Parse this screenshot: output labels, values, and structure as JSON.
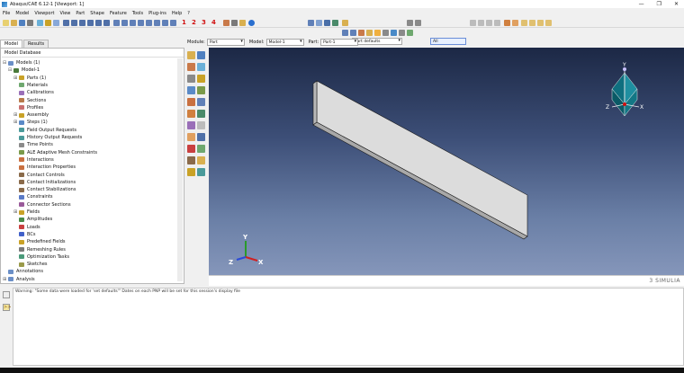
{
  "window": {
    "title": "Abaqus/CAE 6.12-1 [Viewport: 1]",
    "controls": [
      "—",
      "❐",
      "✕"
    ]
  },
  "menu": [
    "File",
    "Model",
    "Viewport",
    "View",
    "Part",
    "Shape",
    "Feature",
    "Tools",
    "Plug-ins",
    "Help",
    "?"
  ],
  "toolbar": {
    "numbers": [
      "1",
      "2",
      "3",
      "4"
    ],
    "render_combo": "Part defaults",
    "filter_value": "All"
  },
  "context_bar": {
    "module_label": "Module:",
    "module_value": "Part",
    "model_label": "Model:",
    "model_value": "Model-1",
    "part_label": "Part:",
    "part_value": "Part-1"
  },
  "left_tabs": [
    "Model",
    "Results"
  ],
  "tree": {
    "header": "Model Database",
    "items": [
      {
        "label": "Models (1)",
        "exp": "⊟",
        "indent": 0,
        "color": "#6b8fc7"
      },
      {
        "label": "Model-1",
        "exp": "⊟",
        "indent": 1,
        "color": "#4a7a3a"
      },
      {
        "label": "Parts (1)",
        "exp": "⊞",
        "indent": 2,
        "color": "#c9a227"
      },
      {
        "label": "Materials",
        "exp": "",
        "indent": 2,
        "color": "#6fa86f"
      },
      {
        "label": "Calibrations",
        "exp": "",
        "indent": 2,
        "color": "#9a6fb8"
      },
      {
        "label": "Sections",
        "exp": "",
        "indent": 2,
        "color": "#b87a4a"
      },
      {
        "label": "Profiles",
        "exp": "",
        "indent": 2,
        "color": "#c97070"
      },
      {
        "label": "Assembly",
        "exp": "⊞",
        "indent": 2,
        "color": "#c9a227"
      },
      {
        "label": "Steps (1)",
        "exp": "⊞",
        "indent": 2,
        "color": "#5a8ac7"
      },
      {
        "label": "Field Output Requests",
        "exp": "",
        "indent": 2,
        "color": "#4a9a9a"
      },
      {
        "label": "History Output Requests",
        "exp": "",
        "indent": 2,
        "color": "#4a9a9a"
      },
      {
        "label": "Time Points",
        "exp": "",
        "indent": 2,
        "color": "#8a8a8a"
      },
      {
        "label": "ALE Adaptive Mesh Constraints",
        "exp": "",
        "indent": 2,
        "color": "#7a9a4a"
      },
      {
        "label": "Interactions",
        "exp": "",
        "indent": 2,
        "color": "#c97040"
      },
      {
        "label": "Interaction Properties",
        "exp": "",
        "indent": 2,
        "color": "#c97040"
      },
      {
        "label": "Contact Controls",
        "exp": "",
        "indent": 2,
        "color": "#8a6a4a"
      },
      {
        "label": "Contact Initializations",
        "exp": "",
        "indent": 2,
        "color": "#8a6a4a"
      },
      {
        "label": "Contact Stabilizations",
        "exp": "",
        "indent": 2,
        "color": "#8a6a4a"
      },
      {
        "label": "Constraints",
        "exp": "",
        "indent": 2,
        "color": "#5a7ac7"
      },
      {
        "label": "Connector Sections",
        "exp": "",
        "indent": 2,
        "color": "#9a5a9a"
      },
      {
        "label": "Fields",
        "exp": "⊞",
        "indent": 2,
        "color": "#c9a227"
      },
      {
        "label": "Amplitudes",
        "exp": "",
        "indent": 2,
        "color": "#4a8a4a"
      },
      {
        "label": "Loads",
        "exp": "",
        "indent": 2,
        "color": "#c94040"
      },
      {
        "label": "BCs",
        "exp": "",
        "indent": 2,
        "color": "#4060c9"
      },
      {
        "label": "Predefined Fields",
        "exp": "",
        "indent": 2,
        "color": "#c9a227"
      },
      {
        "label": "Remeshing Rules",
        "exp": "",
        "indent": 2,
        "color": "#7a7a7a"
      },
      {
        "label": "Optimization Tasks",
        "exp": "",
        "indent": 2,
        "color": "#4a9a7a"
      },
      {
        "label": "Sketches",
        "exp": "",
        "indent": 2,
        "color": "#9a9a4a"
      },
      {
        "label": "Annotations",
        "exp": "",
        "indent": 0,
        "color": "#6b8fc7"
      },
      {
        "label": "Analysis",
        "exp": "⊞",
        "indent": 0,
        "color": "#6b8fc7"
      }
    ]
  },
  "triad": {
    "x": "X",
    "y": "Y",
    "z": "Z"
  },
  "view_cube": {
    "x": "X",
    "y": "Y",
    "z": "Z"
  },
  "brand": "3 SIMULIA",
  "message": "Warning: \"Some data were loaded for 'set defaults'\" Dates on each PNP will be set for this session's display file"
}
